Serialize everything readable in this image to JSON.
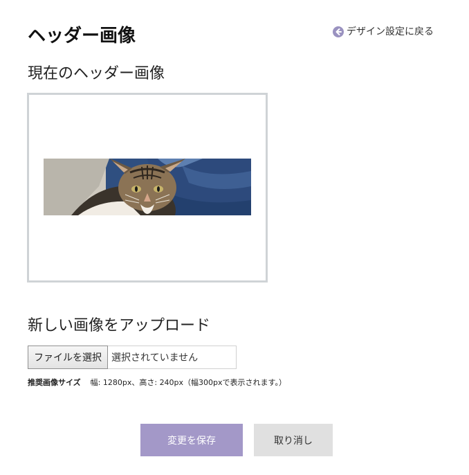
{
  "header": {
    "title": "ヘッダー画像",
    "back_link": "デザイン設定に戻る",
    "back_icon": "arrow-left-circle-icon"
  },
  "current": {
    "heading": "現在のヘッダー画像"
  },
  "upload": {
    "heading": "新しい画像をアップロード",
    "file_button": "ファイルを選択",
    "file_status": "選択されていません",
    "hint_label": "推奨画像サイズ",
    "hint_text": "幅: 1280px、高さ: 240px（幅300pxで表示されます。）"
  },
  "actions": {
    "save": "変更を保存",
    "cancel": "取り消し"
  },
  "colors": {
    "accent": "#a398c8",
    "secondary_button": "#e0e0e0",
    "frame_border": "#cfd3d6"
  }
}
